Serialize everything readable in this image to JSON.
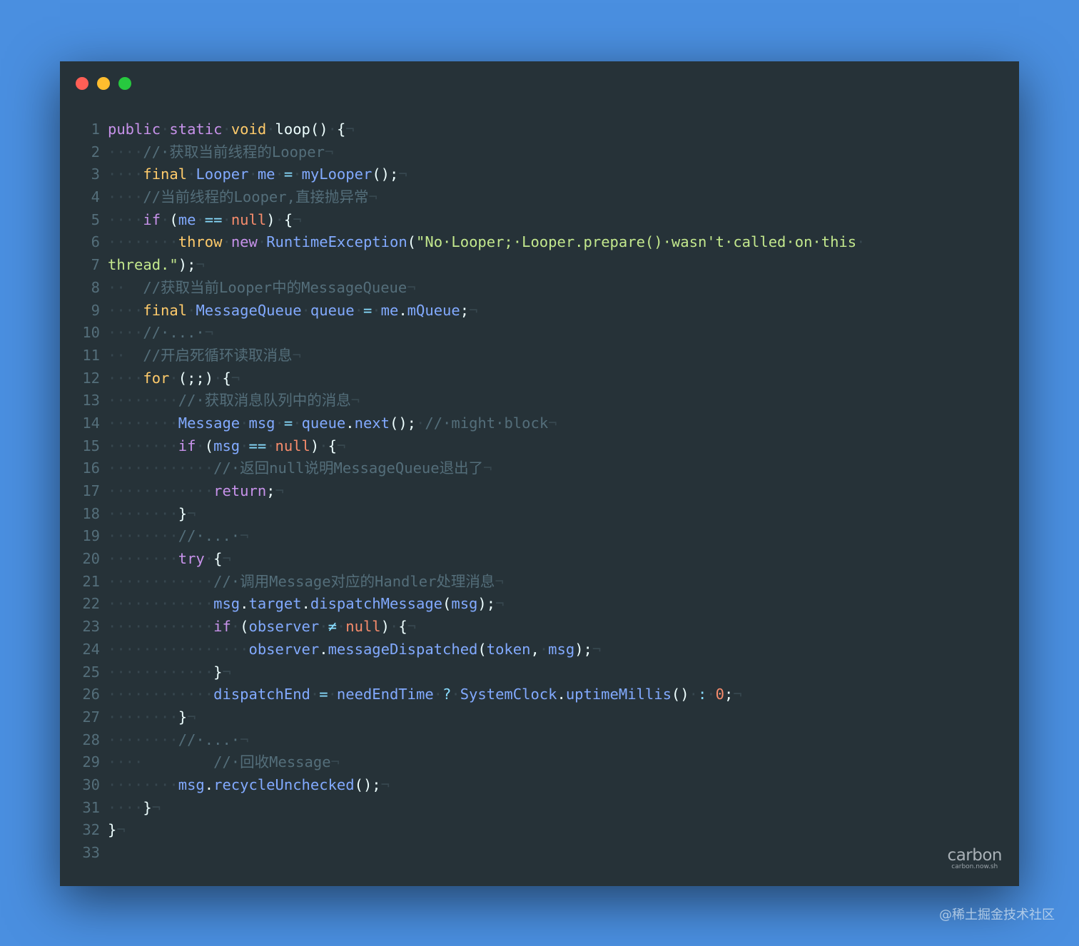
{
  "window": {
    "controls": [
      "close",
      "minimize",
      "zoom"
    ]
  },
  "code": {
    "lines": [
      {
        "n": "1",
        "tokens": [
          [
            "kw",
            "public"
          ],
          [
            "ws",
            "·"
          ],
          [
            "kw",
            "static"
          ],
          [
            "ws",
            "·"
          ],
          [
            "ty",
            "void"
          ],
          [
            "ws",
            "·"
          ],
          [
            "plain",
            "loop()"
          ],
          [
            "ws",
            "·"
          ],
          [
            "plain",
            "{"
          ],
          [
            "ws",
            "¬"
          ]
        ]
      },
      {
        "n": "2",
        "tokens": [
          [
            "ws",
            "····"
          ],
          [
            "cm",
            "//·获取当前线程的Looper"
          ],
          [
            "ws",
            "¬"
          ]
        ]
      },
      {
        "n": "3",
        "tokens": [
          [
            "ws",
            "····"
          ],
          [
            "ty",
            "final"
          ],
          [
            "ws",
            "·"
          ],
          [
            "fn",
            "Looper"
          ],
          [
            "ws",
            "·"
          ],
          [
            "id",
            "me"
          ],
          [
            "ws",
            "·"
          ],
          [
            "op",
            "="
          ],
          [
            "ws",
            "·"
          ],
          [
            "fn",
            "myLooper"
          ],
          [
            "plain",
            "();"
          ],
          [
            "ws",
            "¬"
          ]
        ]
      },
      {
        "n": "4",
        "tokens": [
          [
            "ws",
            "····"
          ],
          [
            "cm",
            "//当前线程的Looper,直接抛异常"
          ],
          [
            "ws",
            "¬"
          ]
        ]
      },
      {
        "n": "5",
        "tokens": [
          [
            "ws",
            "····"
          ],
          [
            "kw",
            "if"
          ],
          [
            "ws",
            "·"
          ],
          [
            "plain",
            "("
          ],
          [
            "id",
            "me"
          ],
          [
            "ws",
            "·"
          ],
          [
            "op",
            "=="
          ],
          [
            "ws",
            "·"
          ],
          [
            "nu",
            "null"
          ],
          [
            "plain",
            ")"
          ],
          [
            "ws",
            "·"
          ],
          [
            "plain",
            "{"
          ],
          [
            "ws",
            "¬"
          ]
        ]
      },
      {
        "n": "6",
        "tokens": [
          [
            "ws",
            "········"
          ],
          [
            "ty",
            "throw"
          ],
          [
            "ws",
            "·"
          ],
          [
            "kw",
            "new"
          ],
          [
            "ws",
            "·"
          ],
          [
            "fn",
            "RuntimeException"
          ],
          [
            "plain",
            "("
          ],
          [
            "str",
            "\"No·Looper;·Looper.prepare()·wasn't·called·on·this"
          ],
          [
            "ws",
            "·"
          ]
        ]
      },
      {
        "n": "7",
        "tokens": [
          [
            "str",
            "thread.\""
          ],
          [
            "plain",
            ");"
          ],
          [
            "ws",
            "¬"
          ]
        ]
      },
      {
        "n": "8",
        "tokens": [
          [
            "ws",
            "··"
          ],
          [
            "plain",
            "  "
          ],
          [
            "cm",
            "//获取当前Looper中的MessageQueue"
          ],
          [
            "ws",
            "¬"
          ]
        ]
      },
      {
        "n": "9",
        "tokens": [
          [
            "ws",
            "····"
          ],
          [
            "ty",
            "final"
          ],
          [
            "ws",
            "·"
          ],
          [
            "fn",
            "MessageQueue"
          ],
          [
            "ws",
            "·"
          ],
          [
            "id",
            "queue"
          ],
          [
            "ws",
            "·"
          ],
          [
            "op",
            "="
          ],
          [
            "ws",
            "·"
          ],
          [
            "id",
            "me"
          ],
          [
            "plain",
            "."
          ],
          [
            "id",
            "mQueue"
          ],
          [
            "plain",
            ";"
          ],
          [
            "ws",
            "¬"
          ]
        ]
      },
      {
        "n": "10",
        "tokens": [
          [
            "ws",
            "····"
          ],
          [
            "cm",
            "//·...·"
          ],
          [
            "ws",
            "¬"
          ]
        ]
      },
      {
        "n": "11",
        "tokens": [
          [
            "ws",
            "··"
          ],
          [
            "plain",
            "  "
          ],
          [
            "cm",
            "//开启死循环读取消息"
          ],
          [
            "ws",
            "¬"
          ]
        ]
      },
      {
        "n": "12",
        "tokens": [
          [
            "ws",
            "····"
          ],
          [
            "ty",
            "for"
          ],
          [
            "ws",
            "·"
          ],
          [
            "plain",
            "(;;)"
          ],
          [
            "ws",
            "·"
          ],
          [
            "plain",
            "{"
          ],
          [
            "ws",
            "¬"
          ]
        ]
      },
      {
        "n": "13",
        "tokens": [
          [
            "ws",
            "········"
          ],
          [
            "cm",
            "//·获取消息队列中的消息"
          ],
          [
            "ws",
            "¬"
          ]
        ]
      },
      {
        "n": "14",
        "tokens": [
          [
            "ws",
            "········"
          ],
          [
            "fn",
            "Message"
          ],
          [
            "ws",
            "·"
          ],
          [
            "id",
            "msg"
          ],
          [
            "ws",
            "·"
          ],
          [
            "op",
            "="
          ],
          [
            "ws",
            "·"
          ],
          [
            "id",
            "queue"
          ],
          [
            "plain",
            "."
          ],
          [
            "fn",
            "next"
          ],
          [
            "plain",
            "();"
          ],
          [
            "ws",
            "·"
          ],
          [
            "cm",
            "//·might·block"
          ],
          [
            "ws",
            "¬"
          ]
        ]
      },
      {
        "n": "15",
        "tokens": [
          [
            "ws",
            "········"
          ],
          [
            "kw",
            "if"
          ],
          [
            "ws",
            "·"
          ],
          [
            "plain",
            "("
          ],
          [
            "id",
            "msg"
          ],
          [
            "ws",
            "·"
          ],
          [
            "op",
            "=="
          ],
          [
            "ws",
            "·"
          ],
          [
            "nu",
            "null"
          ],
          [
            "plain",
            ")"
          ],
          [
            "ws",
            "·"
          ],
          [
            "plain",
            "{"
          ],
          [
            "ws",
            "¬"
          ]
        ]
      },
      {
        "n": "16",
        "tokens": [
          [
            "ws",
            "············"
          ],
          [
            "cm",
            "//·返回null说明MessageQueue退出了"
          ],
          [
            "ws",
            "¬"
          ]
        ]
      },
      {
        "n": "17",
        "tokens": [
          [
            "ws",
            "············"
          ],
          [
            "kw",
            "return"
          ],
          [
            "plain",
            ";"
          ],
          [
            "ws",
            "¬"
          ]
        ]
      },
      {
        "n": "18",
        "tokens": [
          [
            "ws",
            "········"
          ],
          [
            "plain",
            "}"
          ],
          [
            "ws",
            "¬"
          ]
        ]
      },
      {
        "n": "19",
        "tokens": [
          [
            "ws",
            "········"
          ],
          [
            "cm",
            "//·...·"
          ],
          [
            "ws",
            "¬"
          ]
        ]
      },
      {
        "n": "20",
        "tokens": [
          [
            "ws",
            "········"
          ],
          [
            "kw",
            "try"
          ],
          [
            "ws",
            "·"
          ],
          [
            "plain",
            "{"
          ],
          [
            "ws",
            "¬"
          ]
        ]
      },
      {
        "n": "21",
        "tokens": [
          [
            "ws",
            "············"
          ],
          [
            "cm",
            "//·调用Message对应的Handler处理消息"
          ],
          [
            "ws",
            "¬"
          ]
        ]
      },
      {
        "n": "22",
        "tokens": [
          [
            "ws",
            "············"
          ],
          [
            "id",
            "msg"
          ],
          [
            "plain",
            "."
          ],
          [
            "id",
            "target"
          ],
          [
            "plain",
            "."
          ],
          [
            "fn",
            "dispatchMessage"
          ],
          [
            "plain",
            "("
          ],
          [
            "id",
            "msg"
          ],
          [
            "plain",
            ");"
          ],
          [
            "ws",
            "¬"
          ]
        ]
      },
      {
        "n": "23",
        "tokens": [
          [
            "ws",
            "············"
          ],
          [
            "kw",
            "if"
          ],
          [
            "ws",
            "·"
          ],
          [
            "plain",
            "("
          ],
          [
            "id",
            "observer"
          ],
          [
            "ws",
            "·"
          ],
          [
            "op",
            "≠"
          ],
          [
            "ws",
            "·"
          ],
          [
            "nu",
            "null"
          ],
          [
            "plain",
            ")"
          ],
          [
            "ws",
            "·"
          ],
          [
            "plain",
            "{"
          ],
          [
            "ws",
            "¬"
          ]
        ]
      },
      {
        "n": "24",
        "tokens": [
          [
            "ws",
            "················"
          ],
          [
            "id",
            "observer"
          ],
          [
            "plain",
            "."
          ],
          [
            "fn",
            "messageDispatched"
          ],
          [
            "plain",
            "("
          ],
          [
            "id",
            "token"
          ],
          [
            "plain",
            ","
          ],
          [
            "ws",
            "·"
          ],
          [
            "id",
            "msg"
          ],
          [
            "plain",
            ");"
          ],
          [
            "ws",
            "¬"
          ]
        ]
      },
      {
        "n": "25",
        "tokens": [
          [
            "ws",
            "············"
          ],
          [
            "plain",
            "}"
          ],
          [
            "ws",
            "¬"
          ]
        ]
      },
      {
        "n": "26",
        "tokens": [
          [
            "ws",
            "············"
          ],
          [
            "id",
            "dispatchEnd"
          ],
          [
            "ws",
            "·"
          ],
          [
            "op",
            "="
          ],
          [
            "ws",
            "·"
          ],
          [
            "id",
            "needEndTime"
          ],
          [
            "ws",
            "·"
          ],
          [
            "op",
            "?"
          ],
          [
            "ws",
            "·"
          ],
          [
            "fn",
            "SystemClock"
          ],
          [
            "plain",
            "."
          ],
          [
            "fn",
            "uptimeMillis"
          ],
          [
            "plain",
            "()"
          ],
          [
            "ws",
            "·"
          ],
          [
            "op",
            ":"
          ],
          [
            "ws",
            "·"
          ],
          [
            "nu",
            "0"
          ],
          [
            "plain",
            ";"
          ],
          [
            "ws",
            "¬"
          ]
        ]
      },
      {
        "n": "27",
        "tokens": [
          [
            "ws",
            "········"
          ],
          [
            "plain",
            "}"
          ],
          [
            "ws",
            "¬"
          ]
        ]
      },
      {
        "n": "28",
        "tokens": [
          [
            "ws",
            "········"
          ],
          [
            "cm",
            "//·...·"
          ],
          [
            "ws",
            "¬"
          ]
        ]
      },
      {
        "n": "29",
        "tokens": [
          [
            "ws",
            "····"
          ],
          [
            "plain",
            "        "
          ],
          [
            "cm",
            "//·回收Message"
          ],
          [
            "ws",
            "¬"
          ]
        ]
      },
      {
        "n": "30",
        "tokens": [
          [
            "ws",
            "········"
          ],
          [
            "id",
            "msg"
          ],
          [
            "plain",
            "."
          ],
          [
            "fn",
            "recycleUnchecked"
          ],
          [
            "plain",
            "();"
          ],
          [
            "ws",
            "¬"
          ]
        ]
      },
      {
        "n": "31",
        "tokens": [
          [
            "ws",
            "····"
          ],
          [
            "plain",
            "}"
          ],
          [
            "ws",
            "¬"
          ]
        ]
      },
      {
        "n": "32",
        "tokens": [
          [
            "plain",
            "}"
          ],
          [
            "ws",
            "¬"
          ]
        ]
      },
      {
        "n": "33",
        "tokens": []
      }
    ]
  },
  "brand": {
    "name": "carbon",
    "url": "carbon.now.sh"
  },
  "watermark": "@稀土掘金技术社区"
}
